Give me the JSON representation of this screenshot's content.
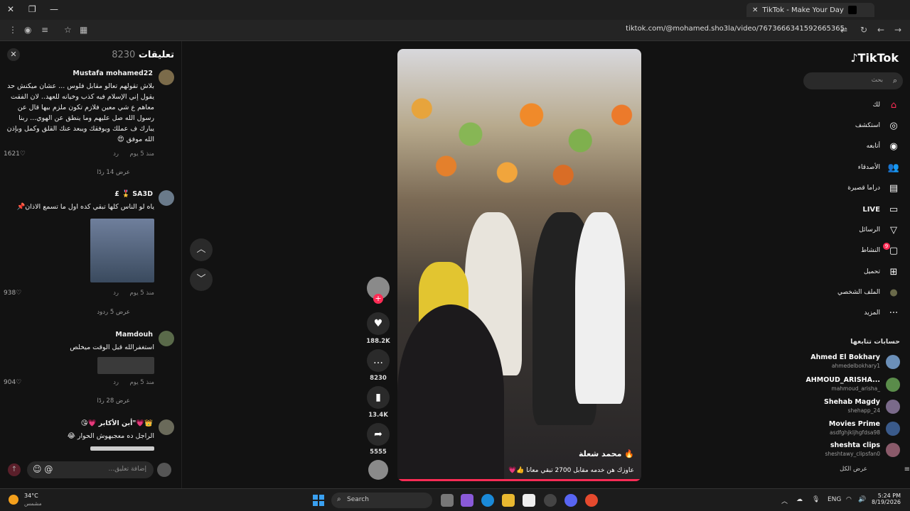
{
  "browser": {
    "tab_title": "TikTok - Make Your Day",
    "url": "tiktok.com/@mohamed.sho3la/video/7673666341592665365"
  },
  "comments_panel": {
    "title": "تعليقات",
    "count": "8230",
    "close_glyph": "✕",
    "input_placeholder": "إضافة تعليق...",
    "items": [
      {
        "user": "Mustafa mohamed22",
        "text": "بلاش تقولهم تعالو مقابل فلوس ... عشان ميكنش حد يقول إني الإسلام فيه كذب وخيانه للعهد.. لان الفقت معاهم ع شي معين فلازم تكون ملزم بيها قال عن رسول الله صل عليهم وما ينطق عن الهوي... ربنا يبارك ف عملك ويوفقك ويبعد عنك القلق وكمل وبإذن الله موفق 😍",
        "time": "منذ 5 يوم",
        "reply": "رد",
        "likes": "1621",
        "replies": "عرض 14 ردًا"
      },
      {
        "user": "SA3D 🎖️ £",
        "text": "ياه لو الناس كلها تبقي كده اول ما تسمع الاذان📌",
        "time": "منذ 5 يوم",
        "reply": "رد",
        "likes": "938",
        "replies": "عرض 5 ردود"
      },
      {
        "user": "Mamdouh",
        "text": "استغفرالله قبل الوقت ميخلص",
        "time": "منذ 5 يوم",
        "reply": "رد",
        "likes": "904",
        "replies": "عرض 28 ردًا"
      },
      {
        "user": "👑💗\"أبن الأكابر 💗😘",
        "text": "الراجل ده معجبهوش الحوار 😂",
        "time": "",
        "reply": "",
        "likes": "",
        "replies": ""
      }
    ]
  },
  "video": {
    "author": "محمد شعلة 🔥",
    "caption": "عاوزك هن خدمه مقابل 2700 تبقي معانا 👍💗"
  },
  "actions": {
    "likes": "188.2K",
    "comments": "8230",
    "saves": "13.4K",
    "shares": "5555"
  },
  "sidebar": {
    "logo": "TikTok",
    "search_placeholder": "بحث",
    "menu": [
      {
        "label": "لك",
        "icon": "⌂"
      },
      {
        "label": "استكشف",
        "icon": "◎"
      },
      {
        "label": "أتابعه",
        "icon": "◉"
      },
      {
        "label": "الأصدقاء",
        "icon": "👥"
      },
      {
        "label": "دراما قصيرة",
        "icon": "▤"
      },
      {
        "label": "LIVE",
        "icon": "▭"
      },
      {
        "label": "الرسائل",
        "icon": "▽"
      },
      {
        "label": "النشاط",
        "icon": "▢",
        "badge": "9"
      },
      {
        "label": "تحميل",
        "icon": "⊞"
      },
      {
        "label": "الملف الشخصي",
        "icon": "●"
      },
      {
        "label": "المزيد",
        "icon": "···"
      }
    ],
    "following_title": "حسابات تتابعها",
    "accounts": [
      {
        "name": "Ahmed El Bokhary",
        "handle": "ahmedelbokhary1",
        "color": "#6b8fb8"
      },
      {
        "name": "AHMOUD_ARISHA...",
        "handle": "mahmoud_arisha_",
        "color": "#5a8c4a"
      },
      {
        "name": "Shehab Magdy",
        "handle": "shehapp_24",
        "color": "#7a6a8a"
      },
      {
        "name": "Movies Prime",
        "handle": "asdfghjkljhgfdsa98",
        "color": "#3a5a8a"
      },
      {
        "name": "sheshta clips",
        "handle": "sheshtawy_clipsfan0",
        "color": "#8a5a6a"
      }
    ],
    "see_all": "عرض الكل"
  },
  "taskbar": {
    "temperature": "34°C",
    "weather_text": "مشمس",
    "search_label": "Search",
    "lang": "ENG",
    "time": "5:24 PM",
    "date": "8/19/2026"
  }
}
